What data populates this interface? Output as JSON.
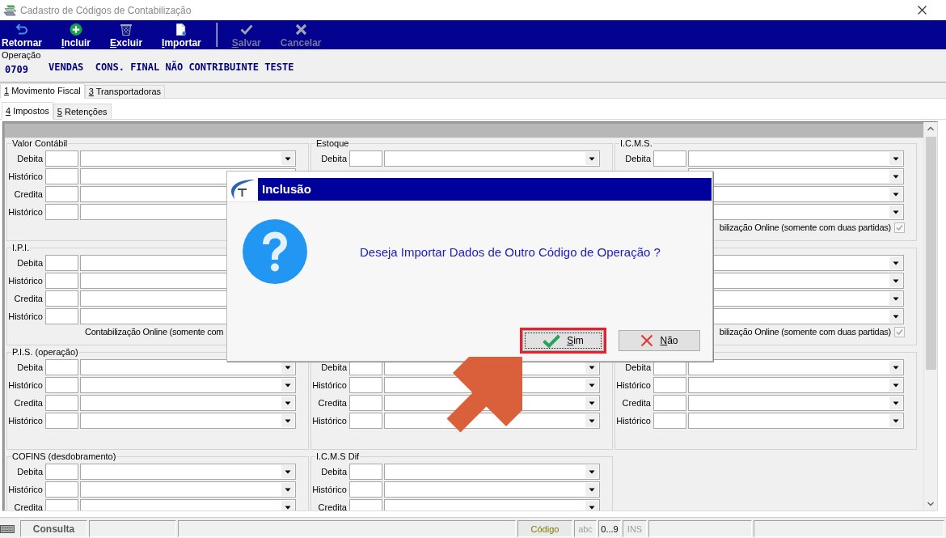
{
  "window": {
    "title": "Cadastro de Códigos de Contabilização"
  },
  "toolbar": [
    {
      "label": "Retornar",
      "mnemonic": false,
      "disabled": false
    },
    {
      "label": "Incluir",
      "mnemonic": true,
      "disabled": false
    },
    {
      "label": "Excluir",
      "mnemonic": true,
      "disabled": false
    },
    {
      "label": "Importar",
      "mnemonic": true,
      "disabled": false
    },
    {
      "label": "Salvar",
      "mnemonic": true,
      "disabled": true
    },
    {
      "label": "Cancelar",
      "mnemonic": false,
      "disabled": true
    }
  ],
  "operation": {
    "label": "Operação",
    "code": "0709",
    "name": "VENDAS  CONS. FINAL NÃO CONTRIBUINTE TESTE"
  },
  "tabs": [
    {
      "label": "1 Movimento Fiscal",
      "mnemonic": true,
      "selected": true
    },
    {
      "label": "3 Transportadoras",
      "mnemonic": true,
      "selected": false
    }
  ],
  "subtabs": [
    {
      "label": "4 Impostos",
      "mnemonic": true,
      "selected": true
    },
    {
      "label": "5 Retenções",
      "mnemonic": true,
      "selected": false
    }
  ],
  "groups": [
    {
      "title": "Valor Contábil",
      "row_labels": [
        "Debita",
        "Histórico",
        "Credita",
        "Histórico"
      ]
    },
    {
      "title": "Estoque",
      "row_labels": [
        "Debita"
      ]
    },
    {
      "title": "I.C.M.S.",
      "row_labels": [
        "Debita"
      ],
      "online": {
        "text": "bilização Online (somente com duas partidas)",
        "checked": true,
        "disabled": true
      }
    },
    {
      "title": "I.P.I.",
      "row_labels": [
        "Debita",
        "Histórico",
        "Credita",
        "Histórico"
      ],
      "online": {
        "text": "Contabilização Online (somente com"
      }
    },
    {
      "online": {
        "text": "bilização Online (somente com duas partidas)",
        "checked": true,
        "disabled": true
      }
    },
    {
      "title": "P.I.S. (operação)",
      "row_labels": [
        "Debita",
        "Histórico",
        "Credita",
        "Histórico"
      ]
    },
    {
      "row_labels": [
        "Debita",
        "Histórico",
        "Credita",
        "Histórico"
      ]
    },
    {
      "row_labels": [
        "Debita",
        "Histórico",
        "Credita",
        "Histórico"
      ]
    },
    {
      "title": "COFINS (desdobramento)",
      "row_labels": [
        "Debita",
        "Histórico",
        "Credita"
      ]
    },
    {
      "title": "I.C.M.S Dif",
      "row_labels": [
        "Debita",
        "Histórico",
        "Credita"
      ]
    }
  ],
  "dialog": {
    "title": "Inclusão",
    "message": "Deseja Importar Dados de Outro Código de Operação ?",
    "buttons": [
      {
        "label": "Sim",
        "mnemonic": true,
        "focused": true,
        "highlighted": true
      },
      {
        "label": "Não",
        "mnemonic": true,
        "focused": false,
        "highlighted": false
      }
    ]
  },
  "status_bar": {
    "mode": "Consulta",
    "field": "Código",
    "indicators": [
      {
        "text": "abc",
        "on": false
      },
      {
        "text": "0...9",
        "on": true
      },
      {
        "text": "INS",
        "on": false
      }
    ]
  }
}
